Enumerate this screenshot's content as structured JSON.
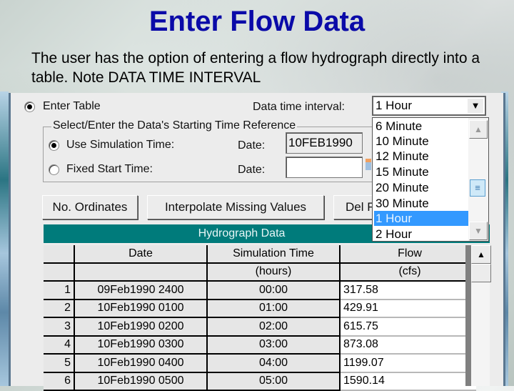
{
  "slide": {
    "title": "Enter Flow Data",
    "subtitle": "The user has the option of entering a flow hydrograph directly into a table.  Note DATA TIME INTERVAL"
  },
  "form": {
    "enter_table_label": "Enter Table",
    "data_time_interval_label": "Data time interval:",
    "data_time_interval_value": "1 Hour",
    "interval_options": [
      "6 Minute",
      "10 Minute",
      "12 Minute",
      "15 Minute",
      "20 Minute",
      "30 Minute",
      "1 Hour",
      "2 Hour"
    ],
    "selected_option": "1 Hour",
    "group_title": "Select/Enter the Data's Starting Time Reference",
    "use_sim_time_label": "Use Simulation Time:",
    "fixed_start_label": "Fixed Start Time:",
    "date_label": "Date:",
    "sim_date_value": "10FEB1990",
    "fixed_date_value": ""
  },
  "buttons": {
    "no_ordinates": "No. Ordinates",
    "interpolate": "Interpolate Missing Values",
    "del_row": "Del Row"
  },
  "table": {
    "title": "Hydrograph Data",
    "headers": [
      "Date",
      "Simulation Time",
      "Flow"
    ],
    "units": [
      "",
      "(hours)",
      "(cfs)"
    ],
    "rows": [
      {
        "n": "1",
        "date": "09Feb1990 2400",
        "time": "00:00",
        "flow": "317.58"
      },
      {
        "n": "2",
        "date": "10Feb1990 0100",
        "time": "01:00",
        "flow": "429.91"
      },
      {
        "n": "3",
        "date": "10Feb1990 0200",
        "time": "02:00",
        "flow": "615.75"
      },
      {
        "n": "4",
        "date": "10Feb1990 0300",
        "time": "03:00",
        "flow": "873.08"
      },
      {
        "n": "5",
        "date": "10Feb1990 0400",
        "time": "04:00",
        "flow": "1199.07"
      },
      {
        "n": "6",
        "date": "10Feb1990 0500",
        "time": "05:00",
        "flow": "1590.14"
      }
    ]
  },
  "icons": {
    "dropdown_arrow": "▼",
    "scroll_up": "▲",
    "scroll_down": "▼",
    "thumb": "≡"
  }
}
